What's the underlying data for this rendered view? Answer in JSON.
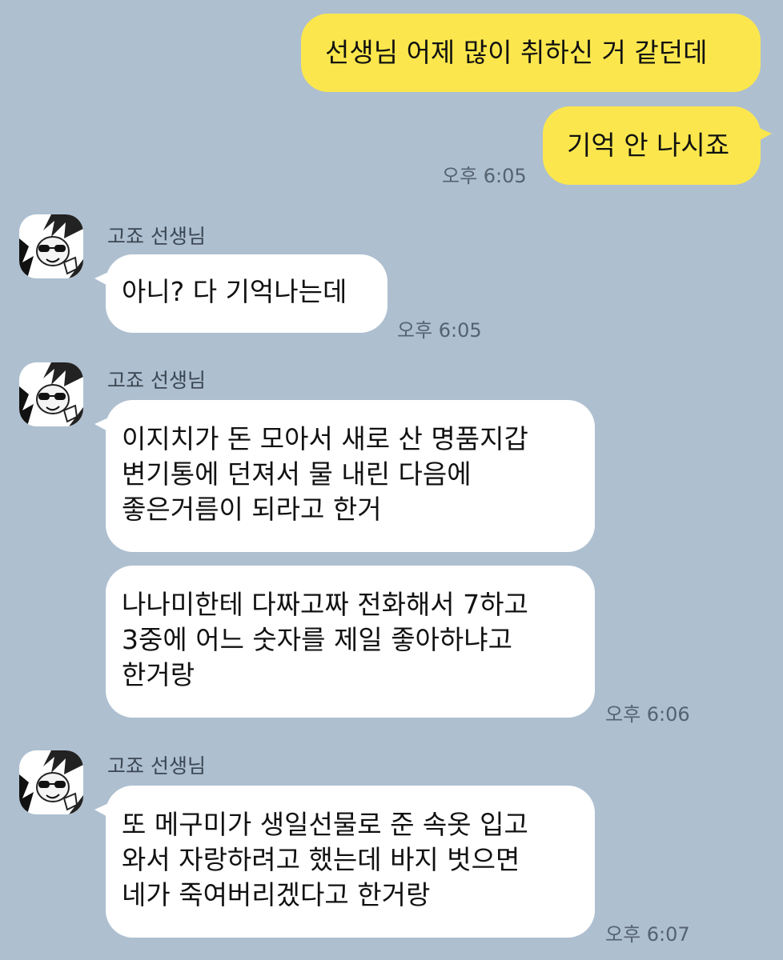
{
  "sender_name": "고죠 선생님",
  "messages": {
    "m1": "선생님 어제 많이 취하신 거 같던데",
    "m2": "기억 안 나시죠",
    "m3": "아니? 다 기억나는데",
    "m4": [
      "이지치가 돈 모아서 새로 산 명품지갑",
      "변기통에 던져서 물 내린 다음에",
      "좋은거름이 되라고 한거"
    ],
    "m5": [
      "나나미한테 다짜고짜 전화해서 7하고",
      "3중에 어느 숫자를 제일 좋아하냐고",
      "한거랑"
    ],
    "m6": [
      "또 메구미가 생일선물로 준 속옷 입고",
      "와서 자랑하려고 했는데 바지 벗으면",
      "네가 죽여버리겠다고 한거랑"
    ]
  },
  "times": {
    "t1": "오후 6:05",
    "t2": "오후 6:05",
    "t3": "오후 6:06",
    "t4": "오후 6:07"
  },
  "colors": {
    "background": "#aebfd0",
    "my_bubble": "#fbe74d",
    "their_bubble": "#ffffff"
  },
  "icons": {
    "avatar": "profile-avatar-icon"
  }
}
